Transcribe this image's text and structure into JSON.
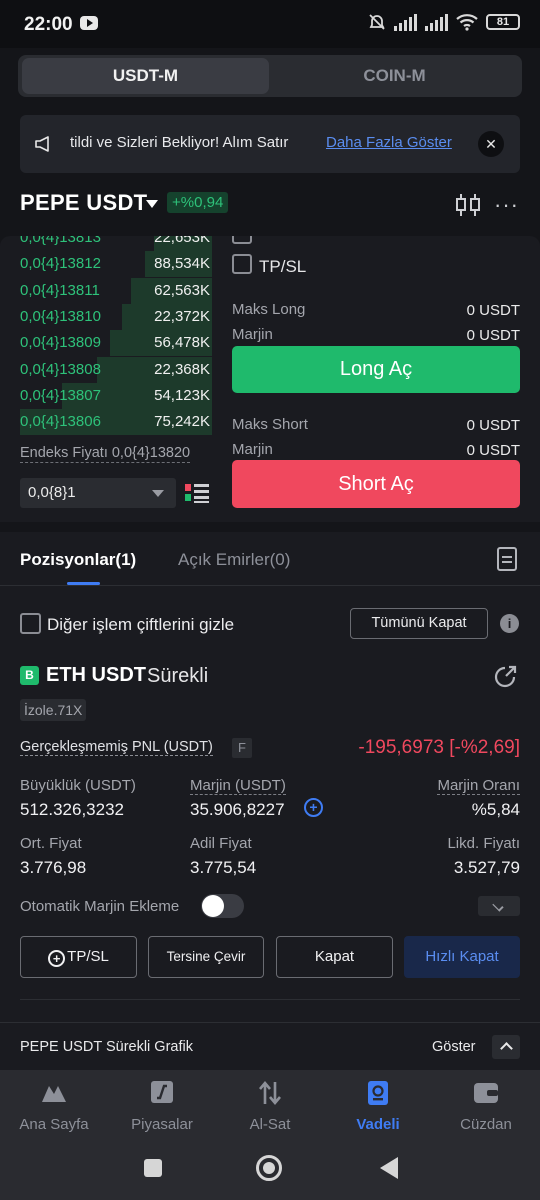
{
  "status": {
    "time": "22:00",
    "battery": "81"
  },
  "tabs": {
    "usdt": "USDT-M",
    "coin": "COIN-M"
  },
  "banner": {
    "text": "tildi ve Sizleri Bekliyor! Alım Satır",
    "link": "Daha Fazla Göster",
    "close": "✕"
  },
  "pair": {
    "title": "PEPE USDT",
    "change": "+%0,94"
  },
  "orderbook": {
    "rows": [
      {
        "price": "0,0{4}13813",
        "qty": "22,653K",
        "fill": 0.3
      },
      {
        "price": "0,0{4}13812",
        "qty": "88,534K",
        "fill": 0.35
      },
      {
        "price": "0,0{4}13811",
        "qty": "62,563K",
        "fill": 0.42
      },
      {
        "price": "0,0{4}13810",
        "qty": "22,372K",
        "fill": 0.47
      },
      {
        "price": "0,0{4}13809",
        "qty": "56,478K",
        "fill": 0.53
      },
      {
        "price": "0,0{4}13808",
        "qty": "22,368K",
        "fill": 0.6
      },
      {
        "price": "0,0{4}13807",
        "qty": "54,123K",
        "fill": 0.78
      },
      {
        "price": "0,0{4}13806",
        "qty": "75,242K",
        "fill": 1.0
      }
    ],
    "index_price": "Endeks Fiyatı 0,0{4}13820",
    "precision": "0,0{8}1"
  },
  "order_form": {
    "tpsl_label": "TP/SL",
    "max_long_label": "Maks Long",
    "max_long_value": "0 USDT",
    "margin_label": "Marjin",
    "margin_long_value": "0 USDT",
    "long_button": "Long Aç",
    "max_short_label": "Maks Short",
    "max_short_value": "0 USDT",
    "margin_short_value": "0 USDT",
    "short_button": "Short Aç"
  },
  "positions": {
    "tab_positions": "Pozisyonlar(1)",
    "tab_orders": "Açık Emirler(0)",
    "hide_pairs_label": "Diğer işlem çiftlerini gizle",
    "close_all": "Tümünü Kapat",
    "position": {
      "badge": "B",
      "symbol": "ETH USDT",
      "type": "Sürekli",
      "isolation": "İzole.71X",
      "pnl_label": "Gerçekleşmemiş PNL (USDT)",
      "pnl_tag": "F",
      "pnl_value": "-195,6973 [-%2,69]",
      "size_label": "Büyüklük (USDT)",
      "size_value": "512.326,3232",
      "margin_label": "Marjin (USDT)",
      "margin_value": "35.906,8227",
      "margin_ratio_label": "Marjin Oranı",
      "margin_ratio_value": "%5,84",
      "entry_label": "Ort. Fiyat",
      "entry_value": "3.776,98",
      "mark_label": "Adil Fiyat",
      "mark_value": "3.775,54",
      "liq_label": "Likd. Fiyatı",
      "liq_value": "3.527,79",
      "auto_margin_label": "Otomatik Marjin Ekleme",
      "auto_margin_on": false
    },
    "actions": {
      "tpsl": "TP/SL",
      "reverse": "Tersine Çevir",
      "close": "Kapat",
      "quick_close": "Hızlı Kapat"
    }
  },
  "chart_bar": {
    "label": "PEPE USDT Sürekli Grafik",
    "show": "Göster"
  },
  "nav": {
    "items": [
      {
        "label": "Ana Sayfa",
        "icon": "home-icon"
      },
      {
        "label": "Piyasalar",
        "icon": "markets-icon"
      },
      {
        "label": "Al-Sat",
        "icon": "trade-icon"
      },
      {
        "label": "Vadeli",
        "icon": "futures-icon",
        "active": true
      },
      {
        "label": "Cüzdan",
        "icon": "wallet-icon"
      }
    ],
    "active_color": "#3f7cf3"
  },
  "ghost_nav": "Ana Sayfa      Piyasalar        Al-Sat         Vadeli        Cüzdan"
}
